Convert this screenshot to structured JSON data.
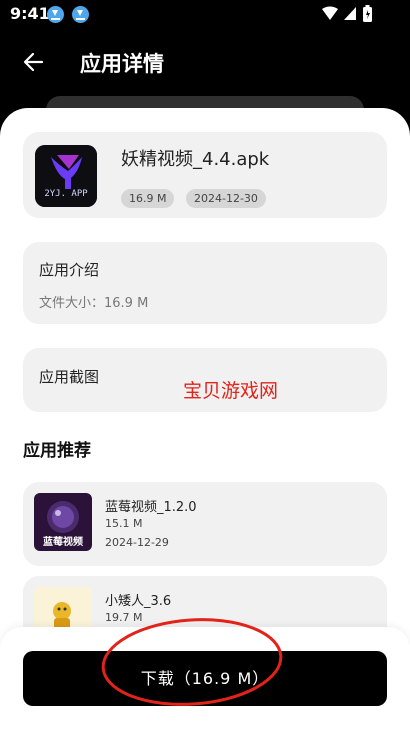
{
  "status_bar": {
    "time": "9:41"
  },
  "header": {
    "title": "应用详情"
  },
  "app": {
    "name": "妖精视频_4.4.apk",
    "icon_text": "2YJ. APP",
    "size": "16.9 M",
    "date": "2024-12-30"
  },
  "intro": {
    "heading": "应用介绍",
    "file_size": "文件大小：16.9 M"
  },
  "screenshots": {
    "heading": "应用截图",
    "watermark": "宝贝游戏网"
  },
  "recommend": {
    "heading": "应用推荐",
    "items": [
      {
        "name": "蓝莓视频_1.2.0",
        "size": "15.1 M",
        "date": "2024-12-29",
        "icon_text": "蓝莓视频"
      },
      {
        "name": "小矮人_3.6",
        "size": "19.7 M",
        "date": ""
      }
    ]
  },
  "download": {
    "label": "下载（16.9 M）"
  },
  "colors": {
    "accent_red": "#e2231a",
    "download_badge": "#4ea7ea",
    "button": "#000000"
  }
}
